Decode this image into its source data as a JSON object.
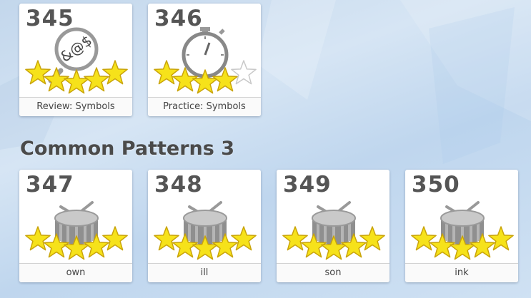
{
  "lessons_top": [
    {
      "number": "345",
      "label": "Review: Symbols",
      "icon": "symbols-magnifier-icon",
      "stars_filled": 5
    },
    {
      "number": "346",
      "label": "Practice: Symbols",
      "icon": "stopwatch-icon",
      "stars_filled": 4
    }
  ],
  "section": {
    "title": "Common Patterns 3"
  },
  "lessons_bottom": [
    {
      "number": "347",
      "label": "own",
      "icon": "drum-icon",
      "stars_filled": 5
    },
    {
      "number": "348",
      "label": "ill",
      "icon": "drum-icon",
      "stars_filled": 5
    },
    {
      "number": "349",
      "label": "son",
      "icon": "drum-icon",
      "stars_filled": 5
    },
    {
      "number": "350",
      "label": "ink",
      "icon": "drum-icon",
      "stars_filled": 5
    }
  ],
  "colors": {
    "star_fill": "#f6e21a",
    "star_empty": "#ffffff",
    "title": "#4a4a4a"
  }
}
